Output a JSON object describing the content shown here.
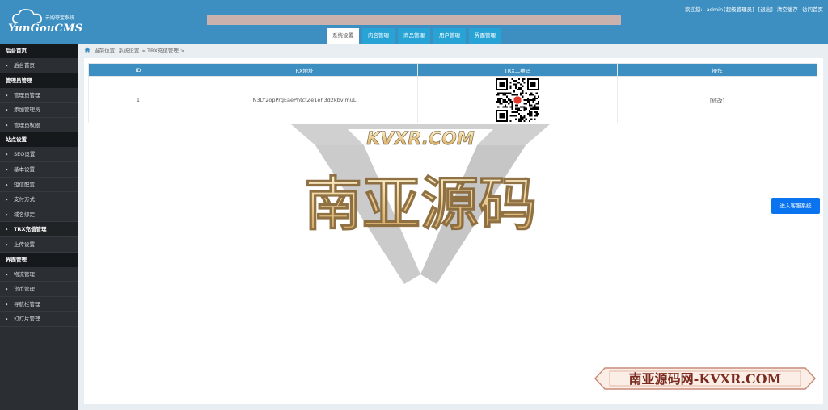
{
  "app": {
    "logo_subtitle": "云购夺宝系统",
    "logo_name": "YunGouCMS"
  },
  "topnav": {
    "welcome": "欢迎您:",
    "user": "admin",
    "role": "[超级管理员]",
    "logout": "[退出]",
    "clear_cache": "清空缓存",
    "visit_home": "访问首页"
  },
  "tabs": [
    {
      "label": "系统设置",
      "active": true
    },
    {
      "label": "内容管理"
    },
    {
      "label": "商品管理"
    },
    {
      "label": "用户管理"
    },
    {
      "label": "界面管理"
    }
  ],
  "sidebar": {
    "sections": [
      {
        "title": "后台首页",
        "items": [
          {
            "label": "后台首页"
          }
        ]
      },
      {
        "title": "管理员管理",
        "items": [
          {
            "label": "管理员管理"
          },
          {
            "label": "添加管理员"
          },
          {
            "label": "管理员权限"
          }
        ]
      },
      {
        "title": "站点设置",
        "items": [
          {
            "label": "SEO设置"
          },
          {
            "label": "基本设置"
          },
          {
            "label": "短信配置"
          },
          {
            "label": "支付方式"
          },
          {
            "label": "域名绑定"
          },
          {
            "label": "TRX充值管理",
            "active": true
          },
          {
            "label": "上传设置"
          }
        ]
      },
      {
        "title": "界面管理",
        "items": [
          {
            "label": "物流管理"
          },
          {
            "label": "货币管理"
          },
          {
            "label": "导航栏管理"
          },
          {
            "label": "幻灯片管理"
          }
        ]
      }
    ]
  },
  "breadcrumb": {
    "current": "当前位置:",
    "level1": "系统设置",
    "sep1": ">",
    "level2": "TRX充值管理",
    "sep2": ">"
  },
  "table": {
    "headers": [
      "ID",
      "TRX地址",
      "TRX二维码",
      "操作"
    ],
    "rows": [
      {
        "id": "1",
        "address": "TN3LY2opPrgEaePhtctZe1eh3d2kbvimuL",
        "action": "[修改]"
      }
    ]
  },
  "cs_button_label": "进入客服系统",
  "watermark": {
    "top_text": "KVXR.COM",
    "main_text": "南亚源码",
    "stamp_text": "南亚源码网-KVXR.COM"
  },
  "colors": {
    "header": "#3d8fc1",
    "tab": "#27a3d6",
    "sidebar": "#2b2f33",
    "button": "#0a74f0"
  }
}
